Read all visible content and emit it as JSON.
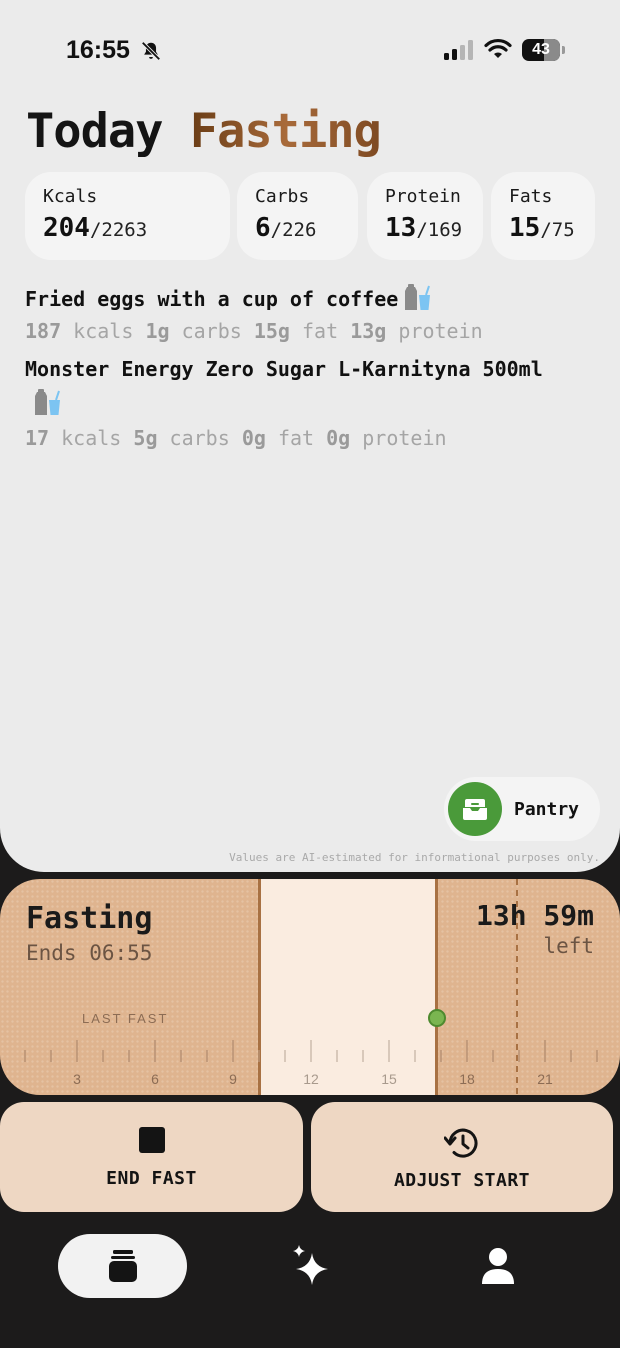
{
  "status_bar": {
    "time": "16:55",
    "battery": "43"
  },
  "header": {
    "title_part1": "Today",
    "title_part2": "Fasting"
  },
  "macros": [
    {
      "label": "Kcals",
      "value": "204",
      "goal": "/2263"
    },
    {
      "label": "Carbs",
      "value": "6",
      "goal": "/226"
    },
    {
      "label": "Protein",
      "value": "13",
      "goal": "/169"
    },
    {
      "label": "Fats",
      "value": "15",
      "goal": "/75"
    }
  ],
  "foods": [
    {
      "name": "Fried eggs with a cup of coffee",
      "kcals": "187",
      "kcals_unit": "kcals",
      "carbs": "1g",
      "carbs_unit": "carbs",
      "fat": "15g",
      "fat_unit": "fat",
      "protein": "13g",
      "protein_unit": "protein"
    },
    {
      "name": "Monster Energy Zero Sugar L-Karnityna 500ml",
      "kcals": "17",
      "kcals_unit": "kcals",
      "carbs": "5g",
      "carbs_unit": "carbs",
      "fat": "0g",
      "fat_unit": "fat",
      "protein": "0g",
      "protein_unit": "protein"
    }
  ],
  "pantry": {
    "label": "Pantry"
  },
  "disclaimer": "Values are AI-estimated for informational purposes only.",
  "fasting": {
    "title": "Fasting",
    "ends": "Ends 06:55",
    "remaining": "13h 59m",
    "remaining_label": "left",
    "last_fast_label": "LAST FAST",
    "hour_labels": [
      "3",
      "6",
      "9",
      "12",
      "15",
      "18",
      "21"
    ]
  },
  "actions": {
    "end_fast": "END FAST",
    "adjust_start": "ADJUST START"
  },
  "colors": {
    "accent_green": "#4a9a3a",
    "fasting_card": "#dfb48f",
    "fasting_window": "#faece0",
    "button_bg": "#eed7c3"
  },
  "icons": {
    "bell": "bell-slash-icon",
    "signal": "cellular-signal-icon",
    "wifi": "wifi-icon",
    "food_bag": "grocery-bag-drink-icon",
    "pantry": "inbox-tray-icon",
    "end": "stop-square-icon",
    "adjust": "history-clock-icon",
    "nav_home": "jar-icon",
    "nav_ai": "sparkles-icon",
    "nav_profile": "person-icon"
  }
}
